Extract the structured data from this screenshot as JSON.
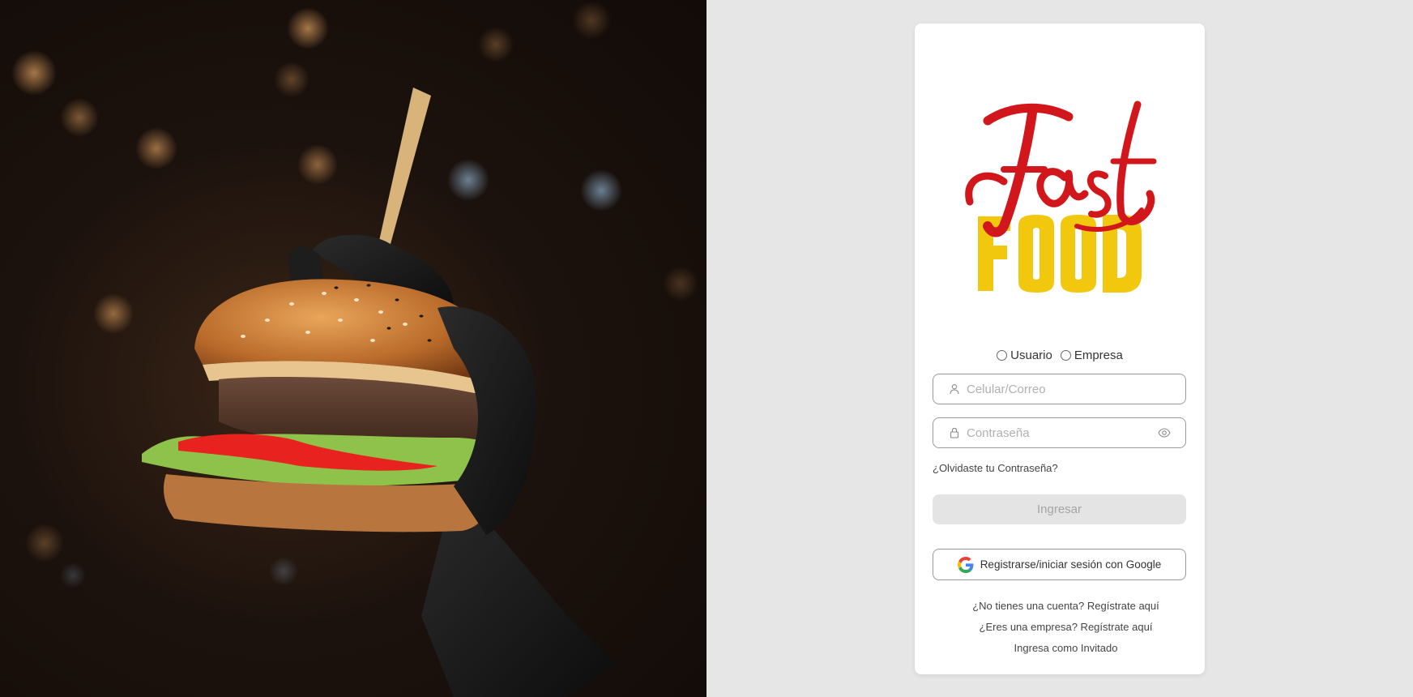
{
  "hero": {
    "image": "burger-held-in-black-glove-photo"
  },
  "logo": {
    "line1": "Fast",
    "line2": "FOOD",
    "colors": {
      "script": "#d2171c",
      "block": "#f2c80f"
    }
  },
  "account_type": {
    "options": [
      {
        "label": "Usuario"
      },
      {
        "label": "Empresa"
      }
    ]
  },
  "login": {
    "user_placeholder": "Celular/Correo",
    "password_placeholder": "Contraseña",
    "user_icon": "user-icon",
    "password_icon": "lock-icon",
    "reveal_icon": "eye-icon",
    "forgot_label": "¿Olvidaste tu Contraseña?",
    "submit_label": "Ingresar",
    "google_label": "Registrarse/iniciar sesión con Google"
  },
  "links": {
    "register_user": "¿No tienes una cuenta? Regístrate aquí",
    "register_company": "¿Eres una empresa? Regístrate aquí",
    "guest": "Ingresa como Invitado"
  },
  "colors": {
    "page_bg": "#e6e6e6",
    "card_bg": "#ffffff",
    "disabled_button_bg": "#e4e4e4"
  }
}
